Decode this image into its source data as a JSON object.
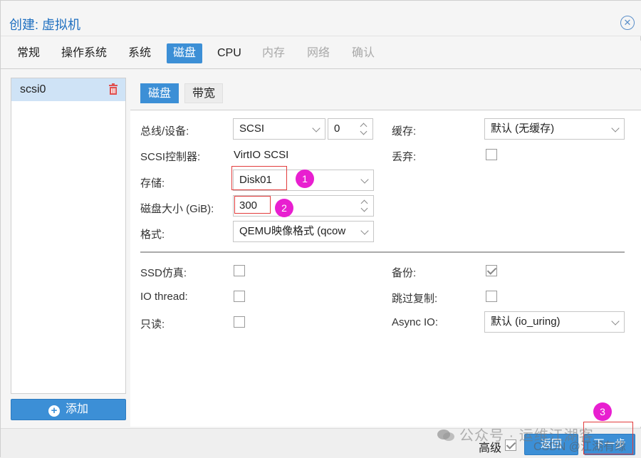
{
  "window": {
    "title": "创建: 虚拟机"
  },
  "tabs": [
    {
      "label": "常规",
      "state": "normal"
    },
    {
      "label": "操作系统",
      "state": "normal"
    },
    {
      "label": "系统",
      "state": "normal"
    },
    {
      "label": "磁盘",
      "state": "active"
    },
    {
      "label": "CPU",
      "state": "normal"
    },
    {
      "label": "内存",
      "state": "disabled"
    },
    {
      "label": "网络",
      "state": "disabled"
    },
    {
      "label": "确认",
      "state": "disabled"
    }
  ],
  "disk_list": {
    "items": [
      {
        "label": "scsi0",
        "selected": true
      }
    ],
    "add_label": "添加"
  },
  "subtabs": [
    {
      "label": "磁盘",
      "active": true
    },
    {
      "label": "带宽",
      "active": false
    }
  ],
  "form": {
    "bus_label": "总线/设备:",
    "bus_value": "SCSI",
    "device_value": "0",
    "scsi_ctrl_label": "SCSI控制器:",
    "scsi_ctrl_value": "VirtIO SCSI",
    "storage_label": "存储:",
    "storage_value": "Disk01",
    "size_label": "磁盘大小 (GiB):",
    "size_value": "300",
    "format_label": "格式:",
    "format_value": "QEMU映像格式 (qcow",
    "cache_label": "缓存:",
    "cache_value": "默认 (无缓存)",
    "discard_label": "丢弃:",
    "discard_checked": false,
    "ssd_label": "SSD仿真:",
    "ssd_checked": false,
    "iothread_label": "IO thread:",
    "iothread_checked": false,
    "readonly_label": "只读:",
    "readonly_checked": false,
    "backup_label": "备份:",
    "backup_checked": true,
    "skip_repl_label": "跳过复制:",
    "skip_repl_checked": false,
    "async_io_label": "Async IO:",
    "async_io_value": "默认 (io_uring)"
  },
  "annotations": {
    "badge1": "1",
    "badge2": "2",
    "badge3": "3"
  },
  "footer": {
    "advanced_label": "高级",
    "advanced_checked": true,
    "back_label": "返回",
    "next_label": "下一步"
  },
  "watermark": {
    "text": "公众号 · 运维江湖客",
    "overlay": "CSDN @江湖有缘"
  },
  "colors": {
    "accent": "#3c8fd6",
    "badge": "#e81fd0",
    "highlight_box": "#e23c3c"
  }
}
